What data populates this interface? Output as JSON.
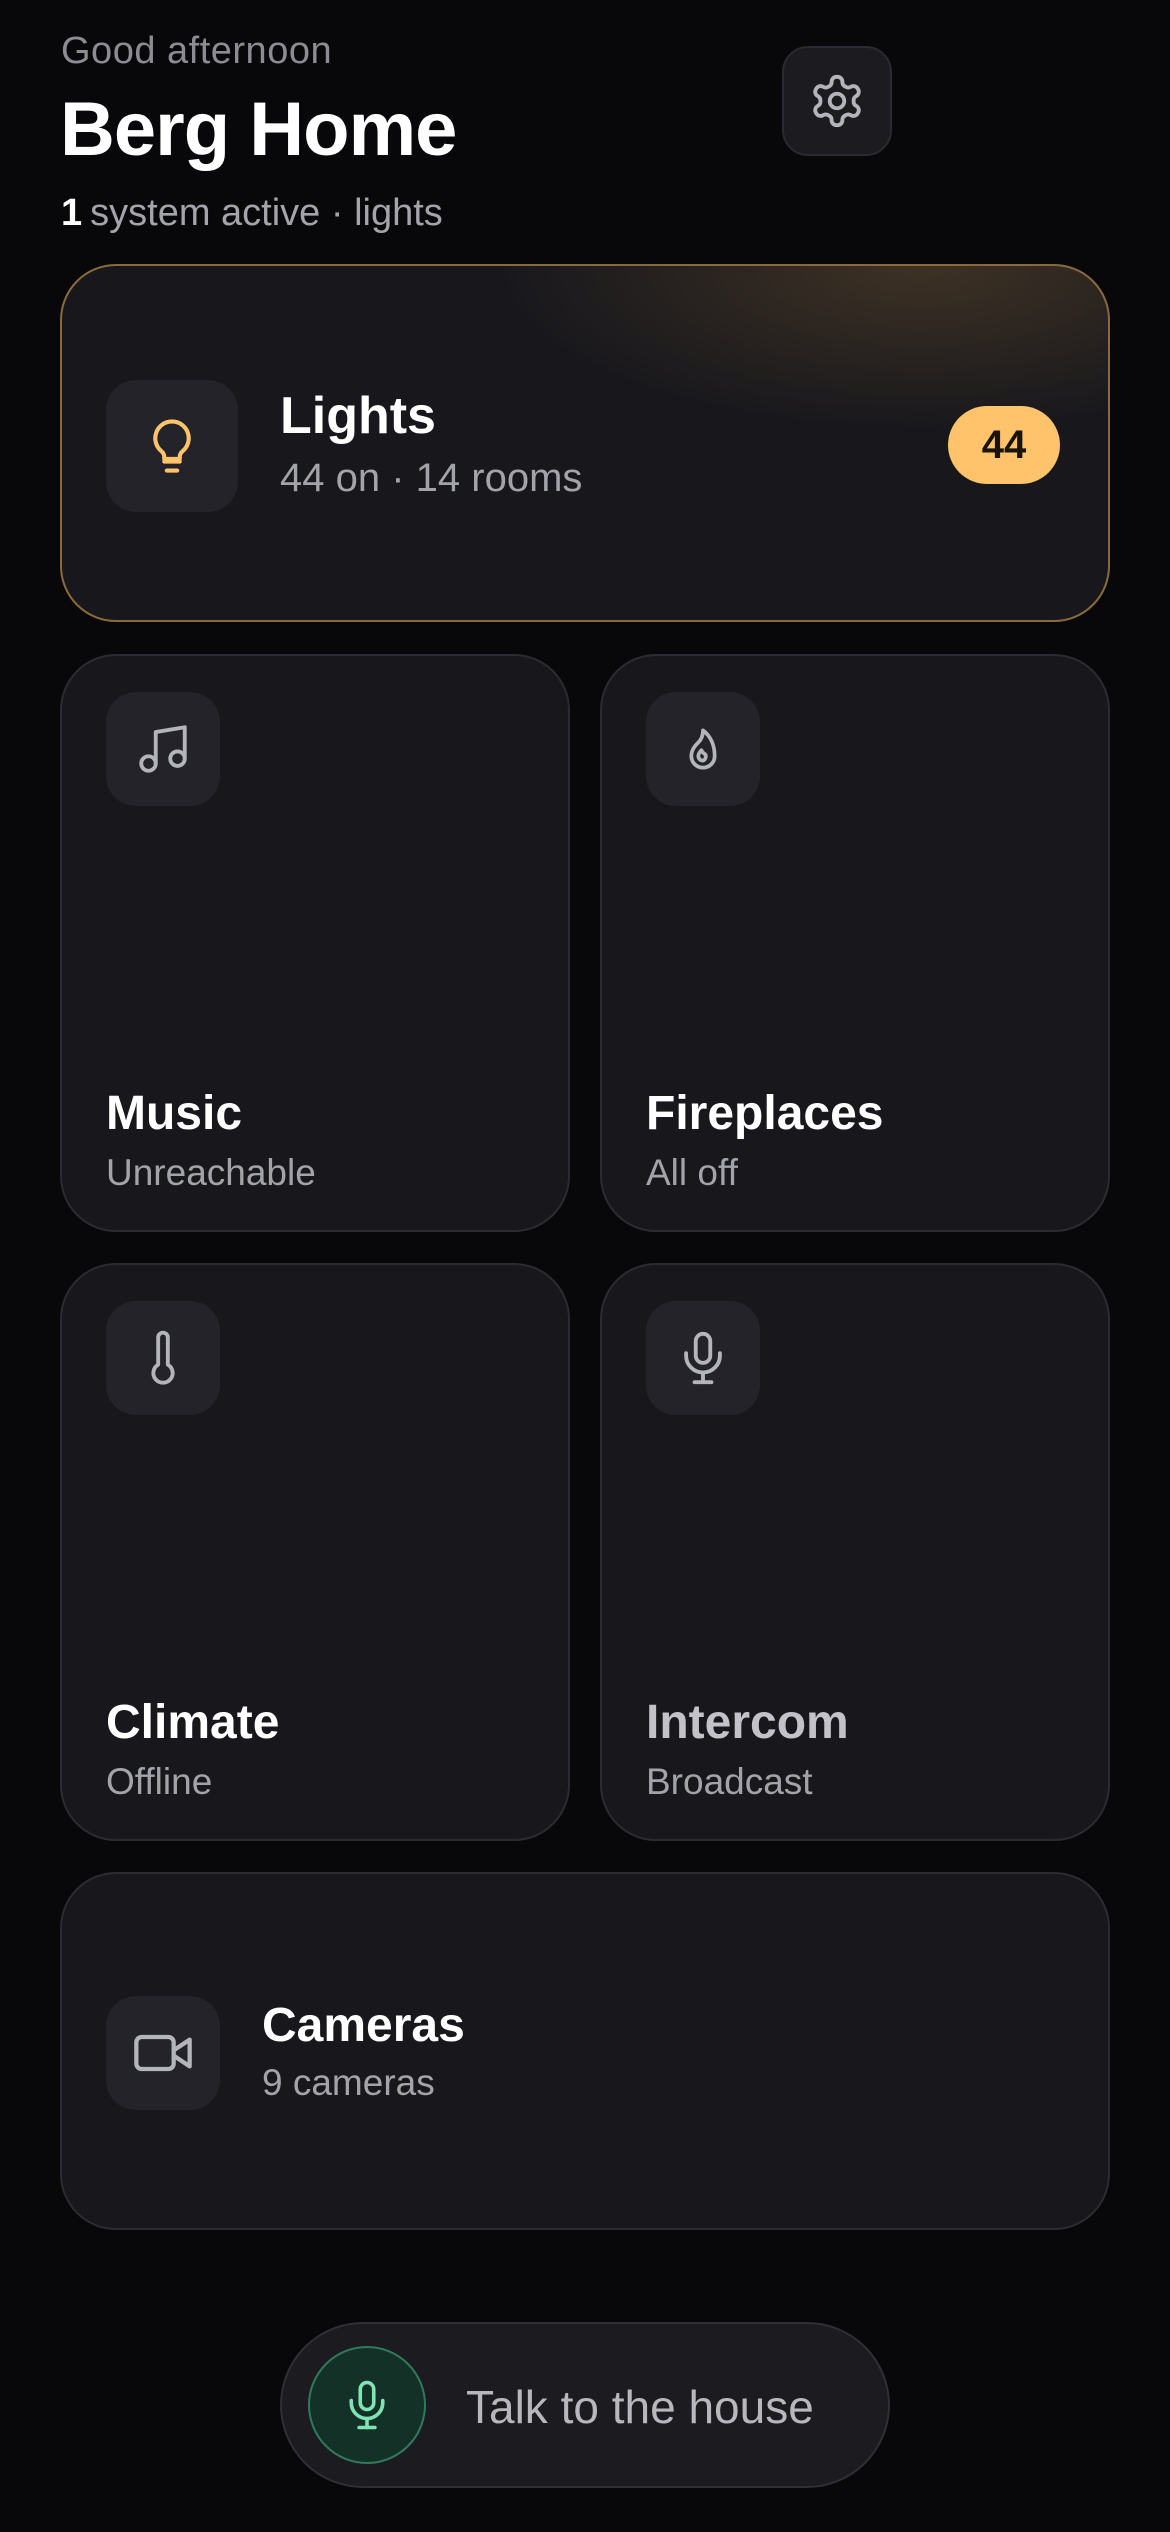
{
  "header": {
    "greeting": "Good afternoon",
    "home_name": "Berg Home",
    "active_count": "1",
    "active_text": "system active · lights",
    "settings_icon": "gear-icon"
  },
  "cards": {
    "lights": {
      "title": "Lights",
      "subtitle": "44 on · 14 rooms",
      "badge": "44",
      "icon": "lightbulb-icon",
      "accent": "#ffc36c"
    },
    "music": {
      "title": "Music",
      "subtitle": "Unreachable",
      "icon": "music-note-icon"
    },
    "fireplaces": {
      "title": "Fireplaces",
      "subtitle": "All off",
      "icon": "flame-icon"
    },
    "climate": {
      "title": "Climate",
      "subtitle": "Offline",
      "icon": "thermometer-icon"
    },
    "intercom": {
      "title": "Intercom",
      "subtitle": "Broadcast",
      "icon": "microphone-icon"
    },
    "cameras": {
      "title": "Cameras",
      "subtitle": "9 cameras",
      "icon": "video-camera-icon"
    }
  },
  "voice": {
    "label": "Talk to the house",
    "icon": "microphone-icon",
    "accent": "#2f7a5c"
  },
  "colors": {
    "background": "#08080a",
    "card": "#17171c",
    "lights_border": "#8a6a3c"
  }
}
